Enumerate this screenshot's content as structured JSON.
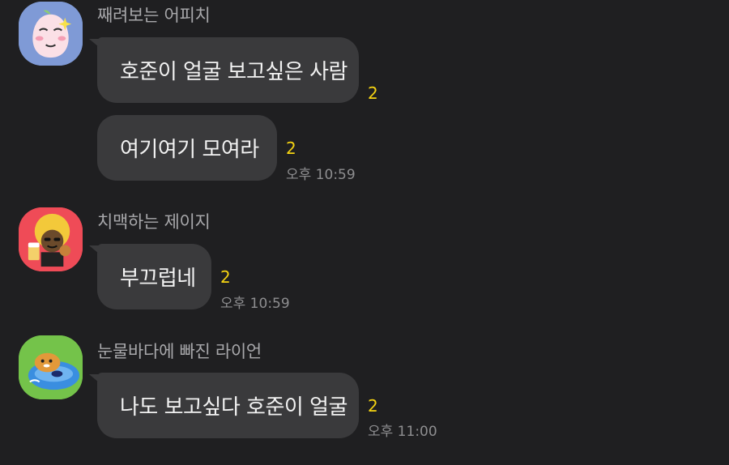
{
  "messages": [
    {
      "sender": "째려보는 어피치",
      "avatar_icon": "peach-character-icon",
      "bubbles": [
        {
          "text": "호준이 얼굴 보고싶은 사람",
          "unread": "2",
          "time": ""
        },
        {
          "text": "여기여기 모여라",
          "unread": "2",
          "time": "오후 10:59"
        }
      ]
    },
    {
      "sender": "치맥하는 제이지",
      "avatar_icon": "afro-character-with-beer-icon",
      "bubbles": [
        {
          "text": "부끄럽네",
          "unread": "2",
          "time": "오후 10:59"
        }
      ]
    },
    {
      "sender": "눈물바다에 빠진 라이언",
      "avatar_icon": "lion-character-floating-icon",
      "bubbles": [
        {
          "text": "나도 보고싶다 호준이 얼굴",
          "unread": "2",
          "time": "오후 11:00"
        }
      ]
    }
  ],
  "colors": {
    "background": "#1f1f21",
    "bubble": "#3a3a3c",
    "unread": "#f5d312",
    "time": "#8e8e90",
    "sender_name": "#a8a8ab"
  }
}
